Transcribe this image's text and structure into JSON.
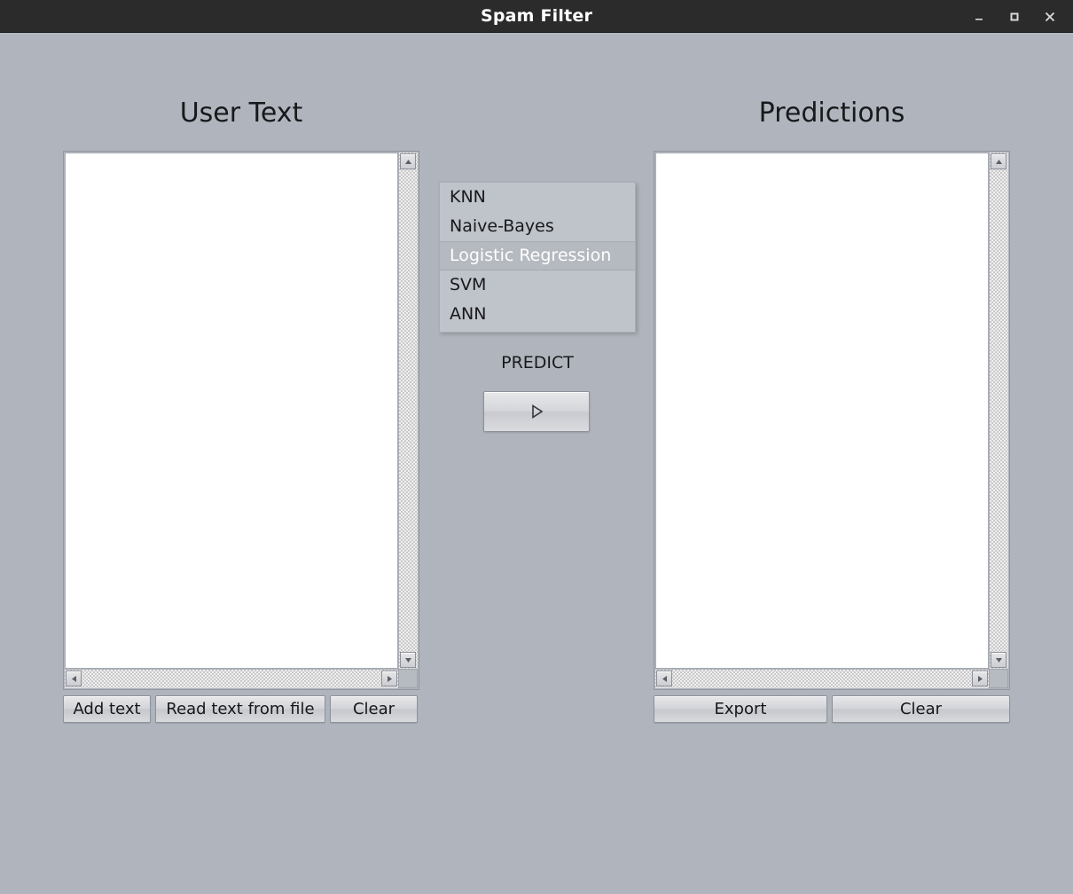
{
  "window": {
    "title": "Spam Filter",
    "controls": [
      {
        "name": "minimize",
        "glyph": "minimize-icon"
      },
      {
        "name": "maximize",
        "glyph": "maximize-icon"
      },
      {
        "name": "close",
        "glyph": "close-icon"
      }
    ],
    "background_color": "#b0b5bd",
    "titlebar_color": "#2b2b2b",
    "titlebar_text_color": "#ffffff"
  },
  "panels": {
    "user": {
      "heading": "User Text",
      "textarea_value": "",
      "buttons": [
        {
          "label": "Add text"
        },
        {
          "label": "Read text from file"
        },
        {
          "label": "Clear"
        }
      ]
    },
    "predictions": {
      "heading": "Predictions",
      "textarea_value": "",
      "buttons": [
        {
          "label": "Export"
        },
        {
          "label": "Clear"
        }
      ]
    }
  },
  "models": {
    "items": [
      {
        "label": "KNN",
        "selected": false
      },
      {
        "label": "Naive-Bayes",
        "selected": false
      },
      {
        "label": "Logistic Regression",
        "selected": true
      },
      {
        "label": "SVM",
        "selected": false
      },
      {
        "label": "ANN",
        "selected": false
      }
    ],
    "selected_value": "Logistic Regression",
    "selected_bg": "#b5b9c0",
    "selected_fg": "#ffffff"
  },
  "predict": {
    "label": "PREDICT",
    "button_icon": "play-triangle-icon"
  },
  "scrollbars": {
    "up_icon": "scroll-up-arrow-icon",
    "down_icon": "scroll-down-arrow-icon",
    "left_icon": "scroll-left-arrow-icon",
    "right_icon": "scroll-right-arrow-icon"
  }
}
